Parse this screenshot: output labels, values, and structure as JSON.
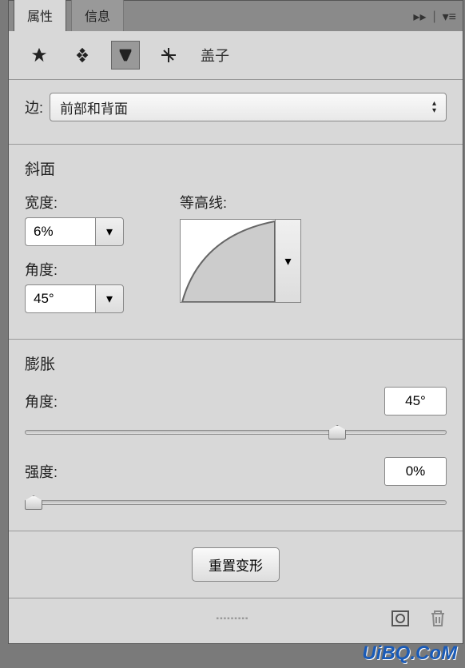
{
  "tabs": {
    "active": "属性",
    "inactive": "信息"
  },
  "toolbar": {
    "label": "盖子"
  },
  "edge": {
    "label": "边:",
    "value": "前部和背面"
  },
  "bevel": {
    "title": "斜面",
    "width_label": "宽度:",
    "width_value": "6%",
    "angle_label": "角度:",
    "angle_value": "45°",
    "contour_label": "等高线:"
  },
  "inflate": {
    "title": "膨胀",
    "angle_label": "角度:",
    "angle_value": "45°",
    "angle_pos": 72,
    "strength_label": "强度:",
    "strength_value": "0%",
    "strength_pos": 0
  },
  "reset": {
    "label": "重置变形"
  },
  "watermark": "UiBQ.CoM"
}
